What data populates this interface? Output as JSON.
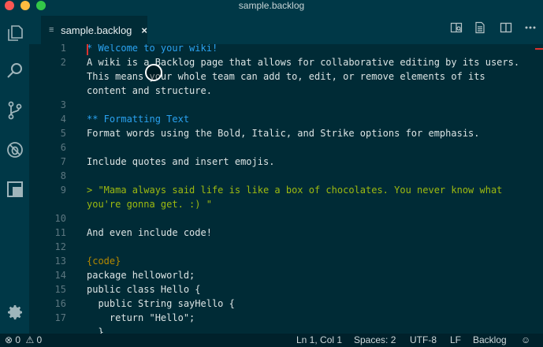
{
  "window": {
    "title": "sample.backlog"
  },
  "activity_bar": {
    "items": [
      "explorer-icon",
      "search-icon",
      "source-control-icon",
      "debug-icon",
      "extensions-icon"
    ],
    "bottom": "settings-gear-icon"
  },
  "tab": {
    "label": "sample.backlog",
    "close": "×",
    "icon": "≡"
  },
  "editor": {
    "lines": [
      {
        "n": "1",
        "text": "* Welcome to your wiki!",
        "kind": "h1"
      },
      {
        "n": "2",
        "text": "A wiki is a Backlog page that allows for collaborative editing by its users.",
        "kind": "plain"
      },
      {
        "n": "",
        "text": "This means your whole team can add to, edit, or remove elements of its",
        "kind": "plain"
      },
      {
        "n": "",
        "text": "content and structure.",
        "kind": "plain"
      },
      {
        "n": "3",
        "text": "",
        "kind": "plain"
      },
      {
        "n": "4",
        "text": "** Formatting Text",
        "kind": "h2"
      },
      {
        "n": "5",
        "text": "Format words using the Bold, Italic, and Strike options for emphasis.",
        "kind": "plain"
      },
      {
        "n": "6",
        "text": "",
        "kind": "plain"
      },
      {
        "n": "7",
        "text": "Include quotes and insert emojis.",
        "kind": "plain"
      },
      {
        "n": "8",
        "text": "",
        "kind": "plain"
      },
      {
        "n": "9",
        "text": "> \"Mama always said life is like a box of chocolates. You never know what",
        "kind": "quote"
      },
      {
        "n": "",
        "text": "you're gonna get. :) \"",
        "kind": "quote"
      },
      {
        "n": "10",
        "text": "",
        "kind": "plain"
      },
      {
        "n": "11",
        "text": "And even include code!",
        "kind": "plain"
      },
      {
        "n": "12",
        "text": "",
        "kind": "plain"
      },
      {
        "n": "13",
        "text": "{code}",
        "kind": "code"
      },
      {
        "n": "14",
        "text": "package helloworld;",
        "kind": "plain"
      },
      {
        "n": "15",
        "text": "public class Hello {",
        "kind": "plain"
      },
      {
        "n": "16",
        "text": "  public String sayHello {",
        "kind": "plain"
      },
      {
        "n": "17",
        "text": "    return \"Hello\";",
        "kind": "plain"
      },
      {
        "n": "",
        "text": "  }",
        "kind": "plain"
      }
    ]
  },
  "status_bar": {
    "errors": "0",
    "warnings": "0",
    "position": "Ln 1, Col 1",
    "spaces": "Spaces: 2",
    "encoding": "UTF-8",
    "eol": "LF",
    "language": "Backlog"
  },
  "colors": {
    "background": "#002b36",
    "heading": "#2aa2f0",
    "quote": "#9dba10",
    "code_tag": "#b58900",
    "cursor": "#dc322f"
  }
}
